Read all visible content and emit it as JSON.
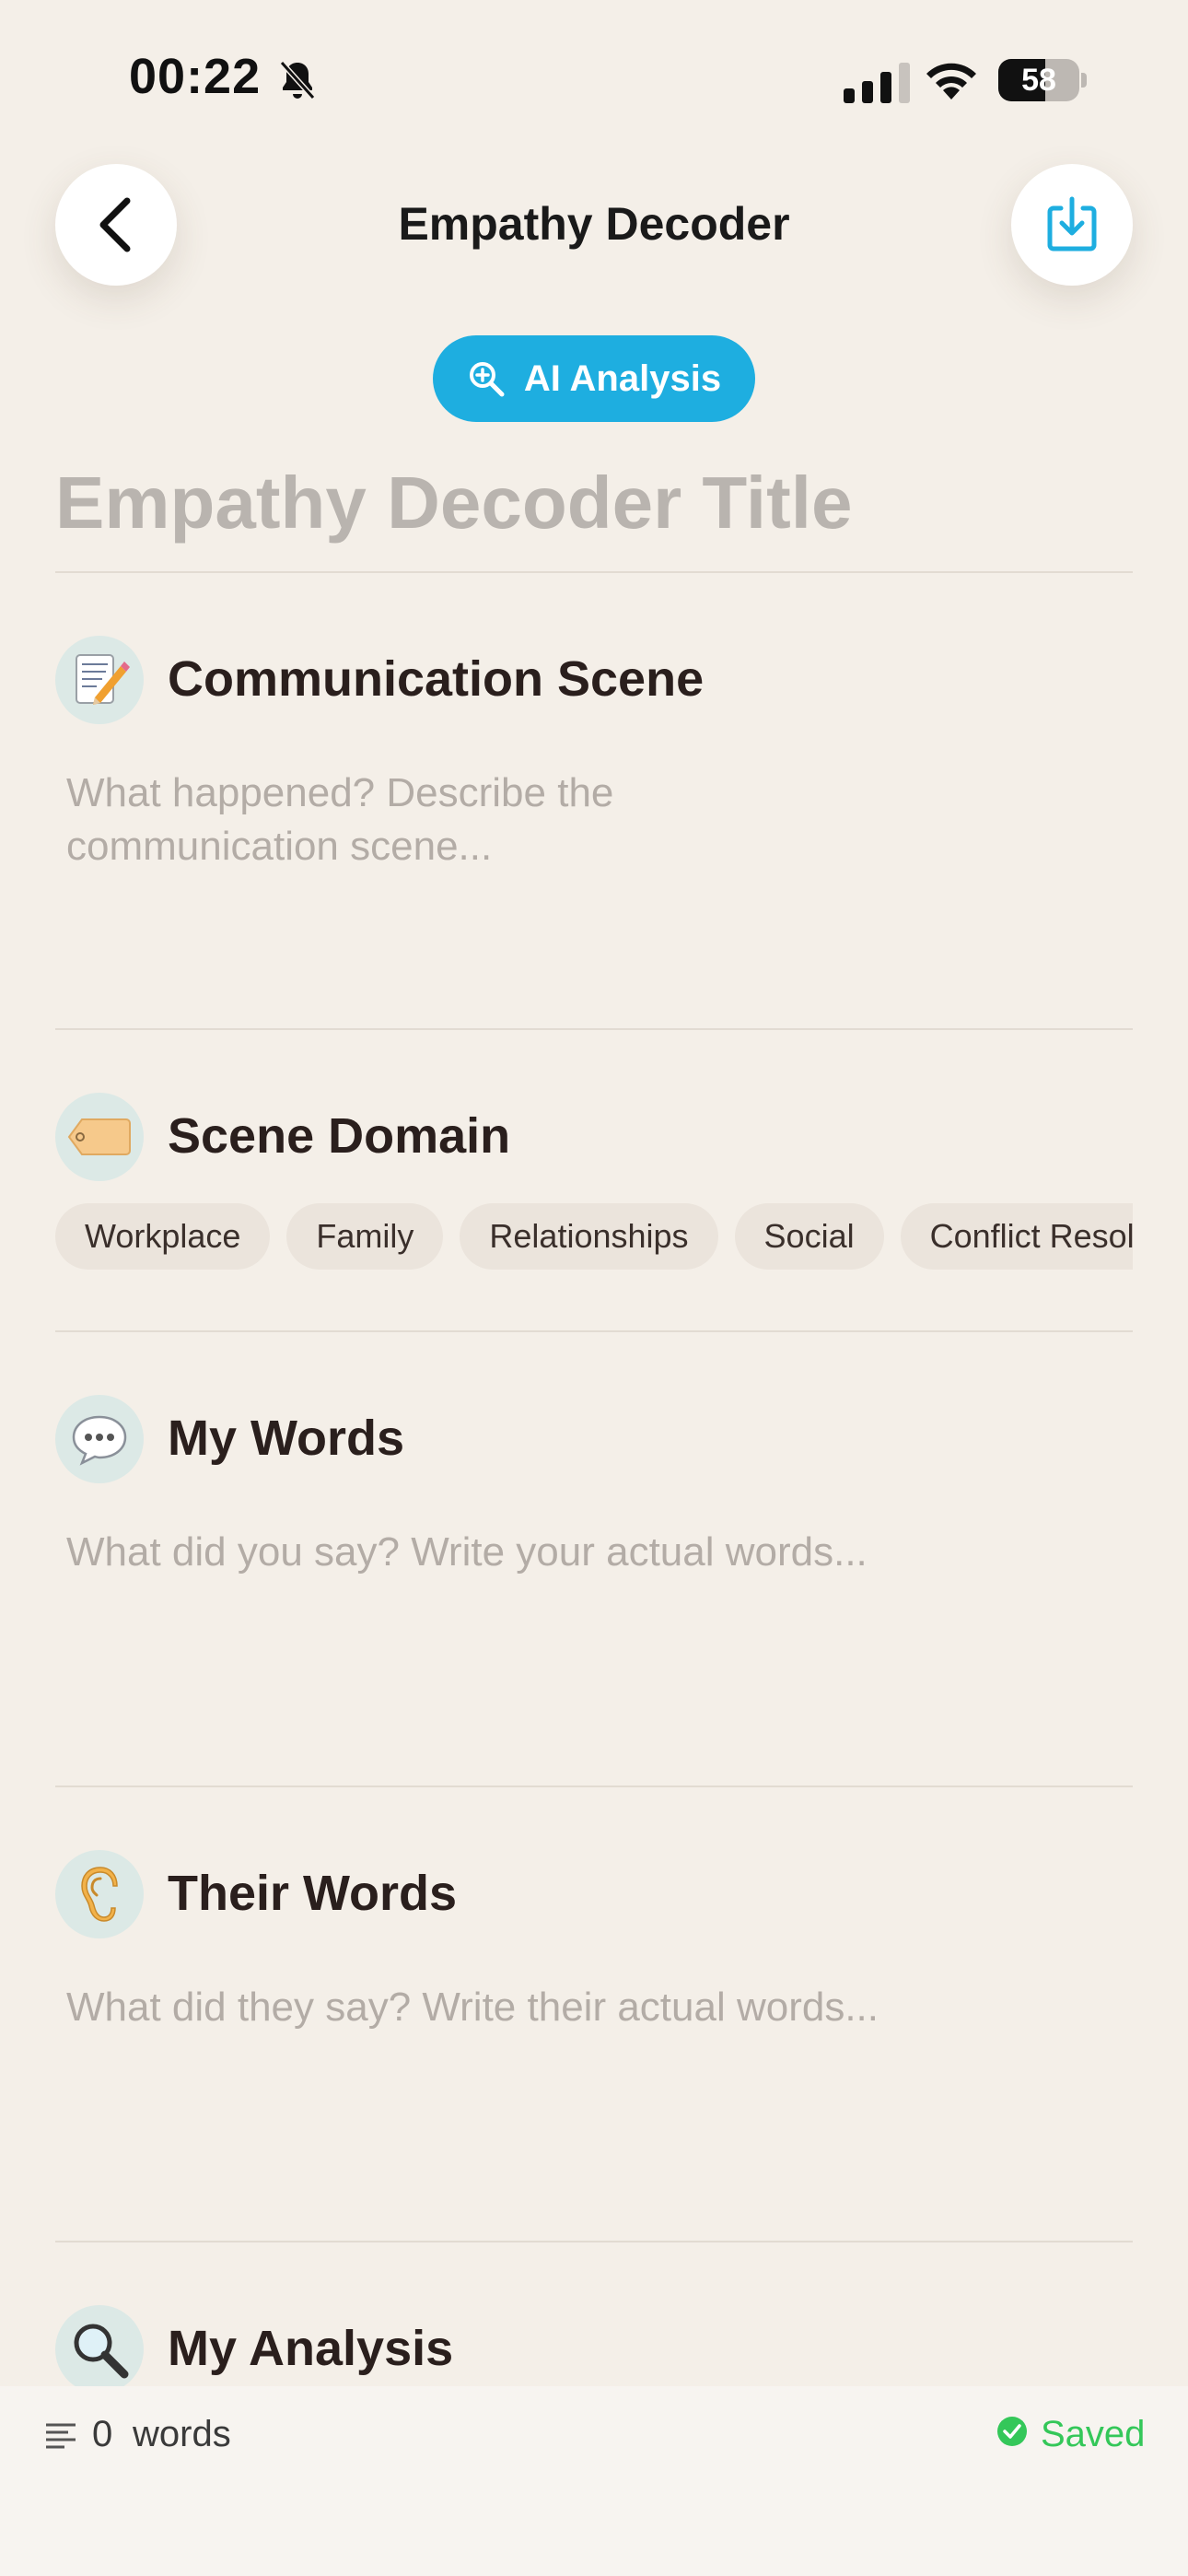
{
  "status_bar": {
    "time": "00:22",
    "battery": "58",
    "battery_level": 0.58
  },
  "header": {
    "title": "Empathy Decoder",
    "back_icon": "chevron-left-icon",
    "export_icon": "download-tray-icon"
  },
  "ai_button": {
    "label": "AI Analysis",
    "icon": "magnifier-plus-icon",
    "color": "#1eaee0"
  },
  "document": {
    "title_placeholder": "Empathy Decoder Title"
  },
  "sections": {
    "communication_scene": {
      "title": "Communication Scene",
      "icon": "memo-emoji",
      "placeholder_line1": "What happened? Describe the",
      "placeholder_line2": "communication scene..."
    },
    "scene_domain": {
      "title": "Scene Domain",
      "icon": "tag-emoji",
      "chips": [
        "Workplace",
        "Family",
        "Relationships",
        "Social",
        "Conflict Resolution"
      ]
    },
    "my_words": {
      "title": "My Words",
      "icon": "speech-balloon-emoji",
      "placeholder": "What did you say? Write your actual words..."
    },
    "their_words": {
      "title": "Their Words",
      "icon": "ear-emoji",
      "placeholder": "What did they say? Write their actual words..."
    },
    "my_analysis": {
      "title": "My Analysis",
      "icon": "magnifying-glass-emoji"
    }
  },
  "footer": {
    "word_count": "0",
    "word_label": "words",
    "saved_label": "Saved",
    "saved_color": "#34c759"
  }
}
